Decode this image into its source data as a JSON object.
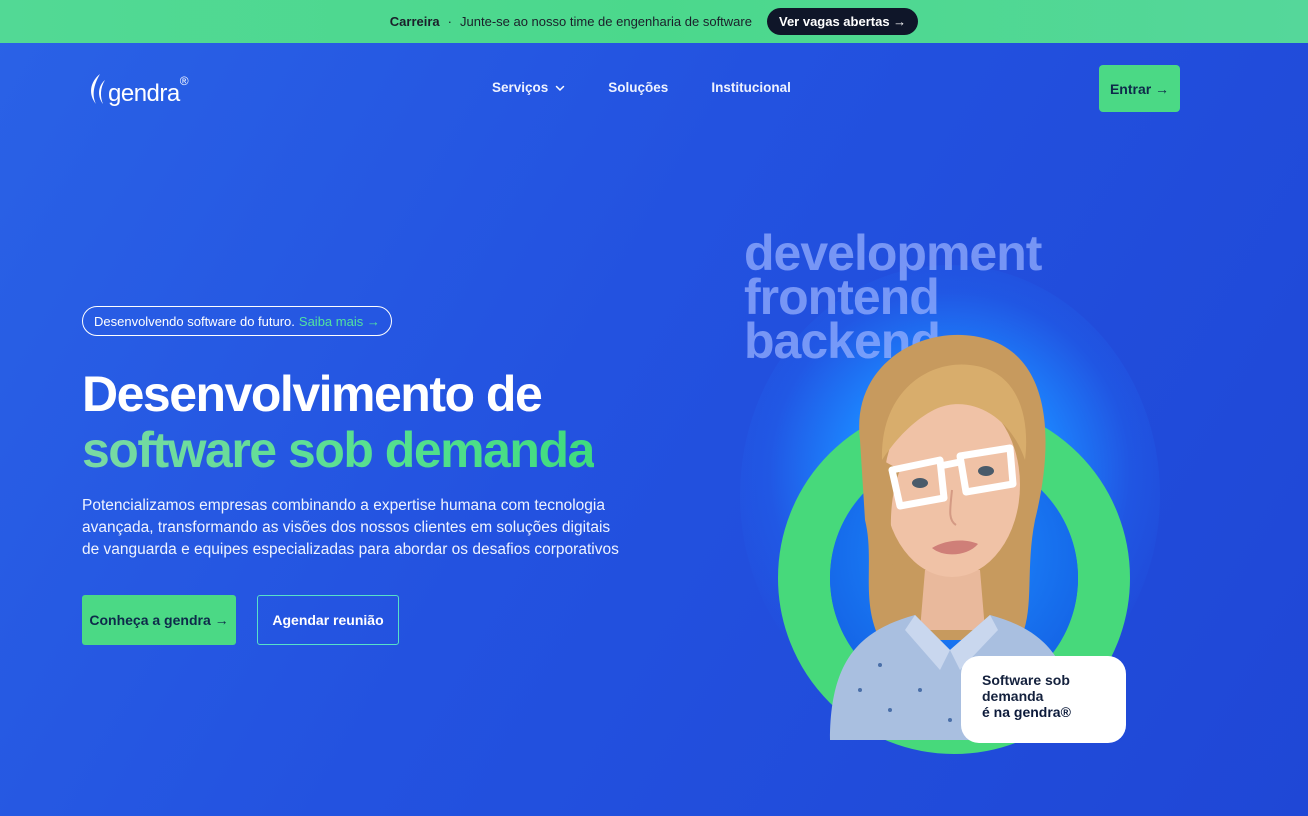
{
  "announcement": {
    "label": "Carreira",
    "separator": "·",
    "text": "Junte-se ao nosso time de engenharia de software",
    "cta": "Ver vagas abertas →"
  },
  "brand": {
    "name": "gendra",
    "reg": "®"
  },
  "nav": {
    "items": [
      {
        "label": "Serviços",
        "has_dropdown": true
      },
      {
        "label": "Soluções",
        "has_dropdown": false
      },
      {
        "label": "Institucional",
        "has_dropdown": false
      }
    ],
    "login": "Entrar →"
  },
  "hero": {
    "pill_text": "Desenvolvendo software do futuro.",
    "pill_link": "Saiba mais →",
    "title_line1": "Desenvolvimento de",
    "title_line2": "software sob demanda",
    "lead": "Potencializamos empresas combinando a expertise humana com tecnologia avançada, transformando as visões dos nossos clientes em soluções digitais de vanguarda e equipes especializadas para abordar os desafios corporativos",
    "primary_cta": "Conheça a gendra →",
    "secondary_cta": "Agendar reunião"
  },
  "visual": {
    "words": [
      "development",
      "frontend",
      "backend"
    ],
    "badge_line1": "Software sob",
    "badge_line2": "demanda",
    "badge_line3": "é na gendra®"
  },
  "colors": {
    "background": "#2352e0",
    "accent_green": "#4bd985",
    "topbar_green": "#4bd88c",
    "dark_navy": "#0f1629"
  }
}
